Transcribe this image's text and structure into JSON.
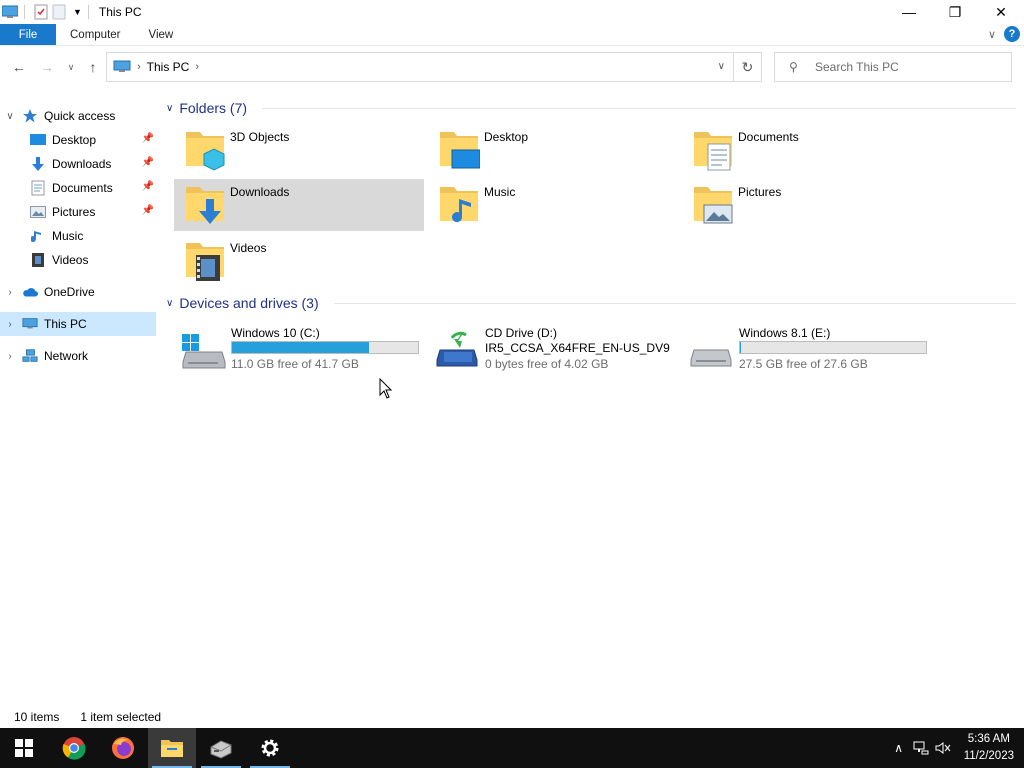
{
  "window": {
    "title": "This PC"
  },
  "titlebar_controls": {
    "minimize": "—",
    "restore": "❐",
    "close": "✕"
  },
  "ribbon": {
    "tabs": [
      "File",
      "Computer",
      "View"
    ],
    "help": "?"
  },
  "address": {
    "crumbs": [
      "This PC"
    ],
    "search_placeholder": "Search This PC"
  },
  "sidebar": {
    "items": [
      {
        "label": "Quick access",
        "icon": "star-icon",
        "expander": "∨"
      },
      {
        "label": "Desktop",
        "icon": "desktop-icon",
        "pinned": true
      },
      {
        "label": "Downloads",
        "icon": "downloads-icon",
        "pinned": true
      },
      {
        "label": "Documents",
        "icon": "documents-icon",
        "pinned": true
      },
      {
        "label": "Pictures",
        "icon": "pictures-icon",
        "pinned": true
      },
      {
        "label": "Music",
        "icon": "music-icon"
      },
      {
        "label": "Videos",
        "icon": "videos-icon"
      },
      {
        "label": "OneDrive",
        "icon": "cloud-icon",
        "expander": "›"
      },
      {
        "label": "This PC",
        "icon": "computer-icon",
        "expander": "›",
        "selected": true
      },
      {
        "label": "Network",
        "icon": "network-icon",
        "expander": "›"
      }
    ]
  },
  "folders": {
    "header": "Folders (7)",
    "items": [
      {
        "name": "3D Objects",
        "icon": "3d-objects-icon"
      },
      {
        "name": "Desktop",
        "icon": "desktop-folder-icon"
      },
      {
        "name": "Documents",
        "icon": "documents-folder-icon"
      },
      {
        "name": "Downloads",
        "icon": "downloads-folder-icon",
        "selected": true
      },
      {
        "name": "Music",
        "icon": "music-folder-icon"
      },
      {
        "name": "Pictures",
        "icon": "pictures-folder-icon"
      },
      {
        "name": "Videos",
        "icon": "videos-folder-icon"
      }
    ]
  },
  "drives": {
    "header": "Devices and drives (3)",
    "items": [
      {
        "name": "Windows 10 (C:)",
        "free": "11.0 GB free of 41.7 GB",
        "used_fraction": 0.736,
        "icon": "windows-drive-icon"
      },
      {
        "name": "CD Drive (D:)",
        "volume": "IR5_CCSA_X64FRE_EN-US_DV9",
        "free": "0 bytes free of 4.02 GB",
        "icon": "cd-drive-icon"
      },
      {
        "name": "Windows 8.1 (E:)",
        "free": "27.5 GB free of 27.6 GB",
        "used_fraction": 0.004,
        "icon": "hard-drive-icon"
      }
    ]
  },
  "status": {
    "count": "10 items",
    "selection": "1 item selected"
  },
  "taskbar": {
    "apps": [
      "start-icon",
      "chrome-icon",
      "firefox-icon",
      "file-explorer-icon",
      "server-manager-icon",
      "settings-icon"
    ],
    "clock_time": "5:36 AM",
    "clock_date": "11/2/2023"
  },
  "colors": {
    "accent": "#1979ca",
    "selection": "#cce8ff",
    "progress": "#26a0da",
    "group_header": "#1e3287"
  }
}
